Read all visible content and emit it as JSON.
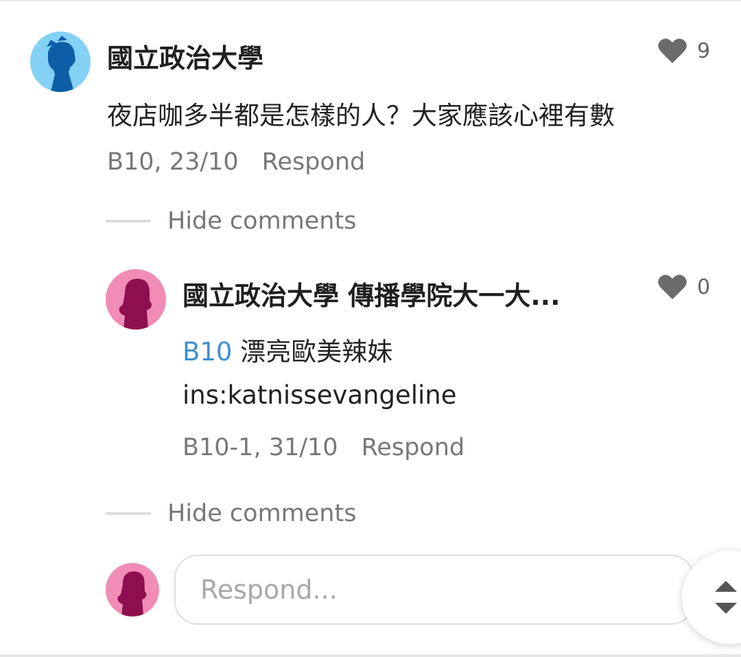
{
  "comment": {
    "author": "國立政治大學",
    "text": "夜店咖多半都是怎樣的人？大家應該心裡有數",
    "floor": "B10, 23/10",
    "respond_label": "Respond",
    "likes": "9",
    "hide_comments_label": "Hide comments"
  },
  "reply": {
    "author": "國立政治大學 傳播學院大一大...",
    "mention": "B10",
    "text_line1": " 漂亮歐美辣妹",
    "text_line2": "ins:katnissevangeline",
    "floor": "B10-1, 31/10",
    "respond_label": "Respond",
    "likes": "0",
    "hide_comments_label": "Hide comments"
  },
  "composer": {
    "placeholder": "Respond..."
  },
  "icons": {
    "like": "heart-icon",
    "scroll": "scroll-up-down-icon",
    "avatar_male": "male-avatar-icon",
    "avatar_female": "female-avatar-icon"
  },
  "colors": {
    "avatar_male_bg": "#84d1f6",
    "avatar_male_fg": "#0d5ea6",
    "avatar_female_bg": "#f08cb5",
    "avatar_female_fg": "#8e0f4f",
    "mention": "#3d8fd1"
  }
}
